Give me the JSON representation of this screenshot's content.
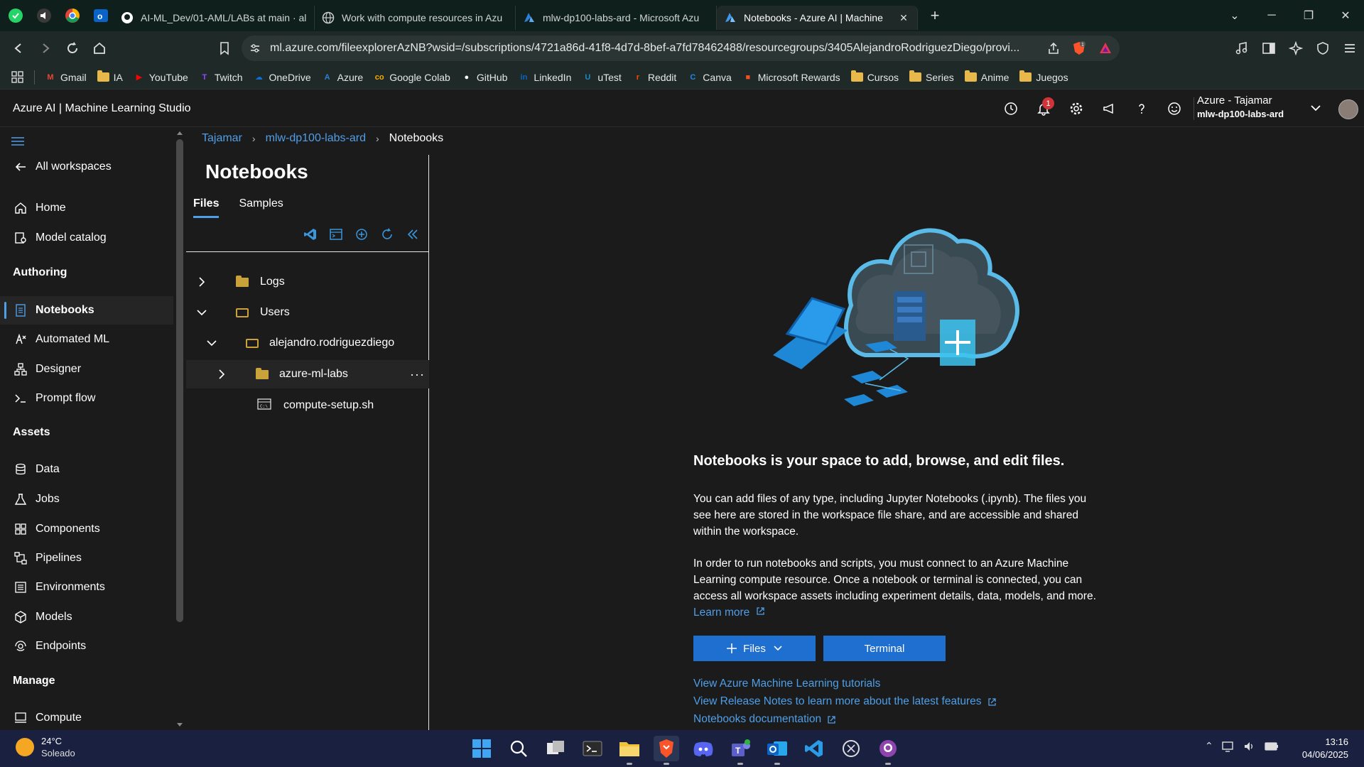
{
  "browser": {
    "tabs": [
      {
        "title": "AI-ML_Dev/01-AML/LABs at main · al",
        "icon": "github-icon"
      },
      {
        "title": "Work with compute resources in Azu",
        "icon": "globe-icon"
      },
      {
        "title": "mlw-dp100-labs-ard - Microsoft Azu",
        "icon": "azure-icon"
      },
      {
        "title": "Notebooks - Azure AI | Machine",
        "icon": "azure-ml-icon",
        "active": true
      }
    ],
    "url": "ml.azure.com/fileexplorerAzNB?wsid=/subscriptions/4721a86d-41f8-4d7d-8bef-a7fd78462488/resourcegroups/3405AlejandroRodriguezDiego/provi...",
    "bookmarks": [
      {
        "label": "Gmail",
        "type": "site",
        "icon": "M",
        "color": "#ea4335"
      },
      {
        "label": "IA",
        "type": "folder"
      },
      {
        "label": "YouTube",
        "type": "site",
        "icon": "▶",
        "color": "#ff0000"
      },
      {
        "label": "Twitch",
        "type": "site",
        "icon": "T",
        "color": "#9146ff"
      },
      {
        "label": "OneDrive",
        "type": "site",
        "icon": "☁",
        "color": "#0a6fd6"
      },
      {
        "label": "Azure",
        "type": "site",
        "icon": "A",
        "color": "#2d7fd6"
      },
      {
        "label": "Google Colab",
        "type": "site",
        "icon": "co",
        "color": "#f9ab00"
      },
      {
        "label": "GitHub",
        "type": "site",
        "icon": "●",
        "color": "#ffffff"
      },
      {
        "label": "LinkedIn",
        "type": "site",
        "icon": "in",
        "color": "#0a66c2"
      },
      {
        "label": "uTest",
        "type": "site",
        "icon": "U",
        "color": "#1b88c8"
      },
      {
        "label": "Reddit",
        "type": "site",
        "icon": "r",
        "color": "#ff4500"
      },
      {
        "label": "Canva",
        "type": "site",
        "icon": "C",
        "color": "#1e88e5"
      },
      {
        "label": "Microsoft Rewards",
        "type": "site",
        "icon": "■",
        "color": "#f25022"
      },
      {
        "label": "Cursos",
        "type": "folder"
      },
      {
        "label": "Series",
        "type": "folder"
      },
      {
        "label": "Anime",
        "type": "folder"
      },
      {
        "label": "Juegos",
        "type": "folder"
      }
    ]
  },
  "app": {
    "title": "Azure AI | Machine Learning Studio",
    "notifications_count": "1",
    "account_line1": "Azure - Tajamar",
    "account_line2": "mlw-dp100-labs-ard"
  },
  "nav": {
    "all_workspaces": "All workspaces",
    "home": "Home",
    "model_catalog": "Model catalog",
    "section_authoring": "Authoring",
    "notebooks": "Notebooks",
    "automated_ml": "Automated ML",
    "designer": "Designer",
    "prompt_flow": "Prompt flow",
    "section_assets": "Assets",
    "data": "Data",
    "jobs": "Jobs",
    "components": "Components",
    "pipelines": "Pipelines",
    "environments": "Environments",
    "models": "Models",
    "endpoints": "Endpoints",
    "section_manage": "Manage",
    "compute": "Compute"
  },
  "breadcrumb": {
    "item1": "Tajamar",
    "item2": "mlw-dp100-labs-ard",
    "current": "Notebooks"
  },
  "files_panel": {
    "title": "Notebooks",
    "tab_files": "Files",
    "tab_samples": "Samples",
    "tree": {
      "logs": "Logs",
      "users": "Users",
      "user_folder": "alejandro.rodriguezdiego",
      "labs_folder": "azure-ml-labs",
      "file": "compute-setup.sh",
      "more": "···"
    }
  },
  "content": {
    "heading": "Notebooks is your space to add, browse, and edit files.",
    "para1": "You can add files of any type, including Jupyter Notebooks (.ipynb). The files you see here are stored in the workspace file share, and are accessible and shared within the workspace.",
    "para2": "In order to run notebooks and scripts, you must connect to an Azure Machine Learning compute resource. Once a notebook or terminal is connected, you can access all workspace assets including experiment details, data, models, and more.",
    "learn_more": "Learn more",
    "files_button": "Files",
    "terminal_button": "Terminal",
    "link_tutorials": "View Azure Machine Learning tutorials",
    "link_release_notes": "View Release Notes to learn more about the latest features",
    "link_docs": "Notebooks documentation"
  },
  "taskbar": {
    "temperature": "24°C",
    "weather": "Soleado",
    "time": "13:16",
    "date": "04/06/2025"
  },
  "colors": {
    "accent": "#4f9ee8",
    "primary_button": "#1f6fd1",
    "background": "#1b1b1b"
  }
}
